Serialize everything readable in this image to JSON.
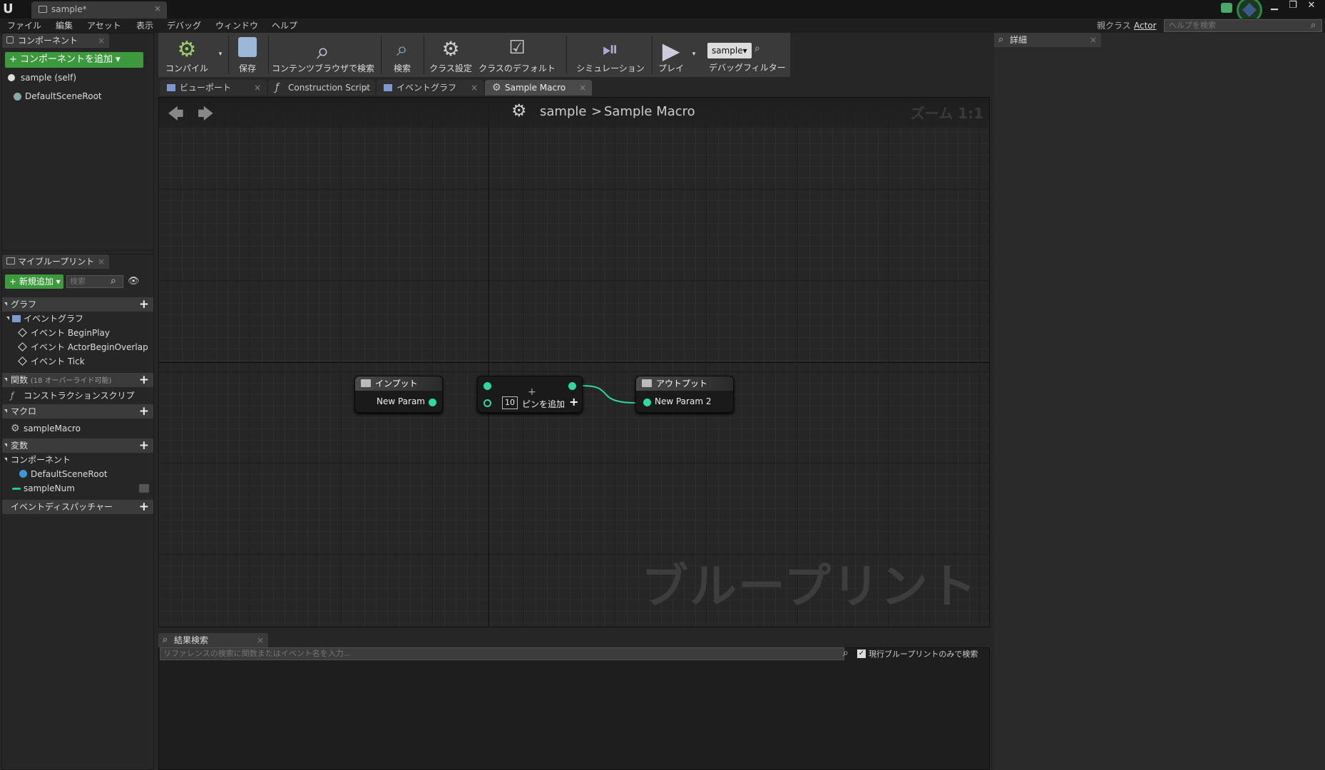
{
  "window": {
    "tab_title": "sample*"
  },
  "menu": [
    "ファイル",
    "編集",
    "アセット",
    "表示",
    "デバッグ",
    "ウィンドウ",
    "ヘルプ"
  ],
  "header_right": {
    "parent_class_label": "親クラス",
    "parent_class_value": "Actor",
    "help_search_placeholder": "ヘルプを検索"
  },
  "components_panel": {
    "title": "コンポーネント",
    "add_button": "+ コンポーネントを追加 ▾",
    "items": [
      "sample (self)",
      "DefaultSceneRoot"
    ]
  },
  "my_blueprint": {
    "title": "マイブループリント",
    "new_button": "+ 新規追加 ▾",
    "search_placeholder": "検索",
    "sections": {
      "graph": "グラフ",
      "event_graph": "イベントグラフ",
      "events": [
        "イベント BeginPlay",
        "イベント ActorBeginOverlap",
        "イベント Tick"
      ],
      "functions": "関数",
      "functions_note": "(18 オーバーライド可能)",
      "construction_script": "コンストラクションスクリプ",
      "macros": "マクロ",
      "macro_items": [
        "sampleMacro"
      ],
      "variables": "変数",
      "components": "コンポーネント",
      "component_items": [
        "DefaultSceneRoot",
        "sampleNum"
      ],
      "dispatchers": "イベントディスパッチャー"
    }
  },
  "toolbar": {
    "compile": "コンパイル",
    "save": "保存",
    "browse": "コンテンツブラウザで検索",
    "find": "検索",
    "class_settings": "クラス設定",
    "class_defaults": "クラスのデフォルト",
    "simulation": "シミュレーション",
    "play": "プレイ",
    "debug_object": "sample▾",
    "debug_filter": "デバッグフィルター"
  },
  "editor_tabs": [
    "ビューポート",
    "Construction Script",
    "イベントグラフ",
    "Sample Macro"
  ],
  "graph": {
    "breadcrumb_root": "sample",
    "breadcrumb_sep": ">",
    "breadcrumb_current": "Sample Macro",
    "zoom": "ズーム 1:1",
    "watermark": "ブループリント",
    "input_node": {
      "title": "インプット",
      "pin": "New Param"
    },
    "middle_node": {
      "value": "10",
      "add_pin": "ピンを追加"
    },
    "output_node": {
      "title": "アウトプット",
      "pin": "New Param 2"
    }
  },
  "find_results": {
    "title": "結果検索",
    "placeholder": "リファレンスの検索に関数またはイベント名を入力...",
    "checkbox_label": "現行ブループリントのみで検索",
    "checkbox_checked": true
  },
  "details_panel": {
    "title": "詳細"
  },
  "colors": {
    "accent_green": "#3c9a3c",
    "exec_pin": "#2ed8a0",
    "graph_bg": "#262626"
  }
}
